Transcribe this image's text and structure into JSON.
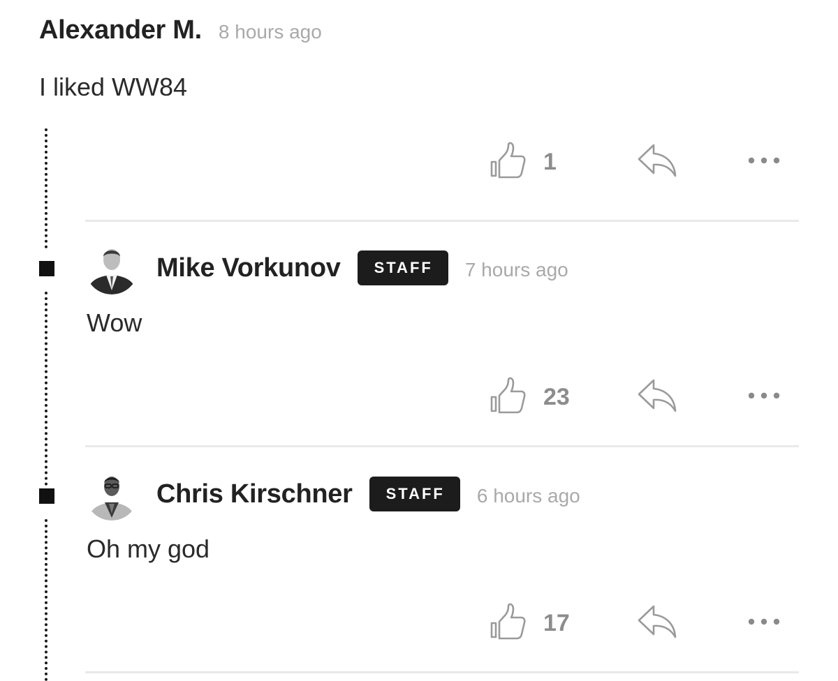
{
  "comment": {
    "author": "Alexander M.",
    "time": "8 hours ago",
    "body": "I liked WW84",
    "likes": "1"
  },
  "replies": [
    {
      "author": "Mike Vorkunov",
      "badge": "STAFF",
      "time": "7 hours ago",
      "body": "Wow",
      "likes": "23"
    },
    {
      "author": "Chris Kirschner",
      "badge": "STAFF",
      "time": "6 hours ago",
      "body": "Oh my god",
      "likes": "17"
    }
  ],
  "icons": {
    "like": "thumbs-up-icon",
    "reply": "reply-arrow-icon",
    "more": "more-dots-icon"
  },
  "colors": {
    "text": "#222222",
    "muted": "#a9a9a9",
    "icon": "#9a9a9a",
    "badge_bg": "#1c1c1c",
    "badge_text": "#ffffff",
    "divider": "#e9e9e9"
  }
}
